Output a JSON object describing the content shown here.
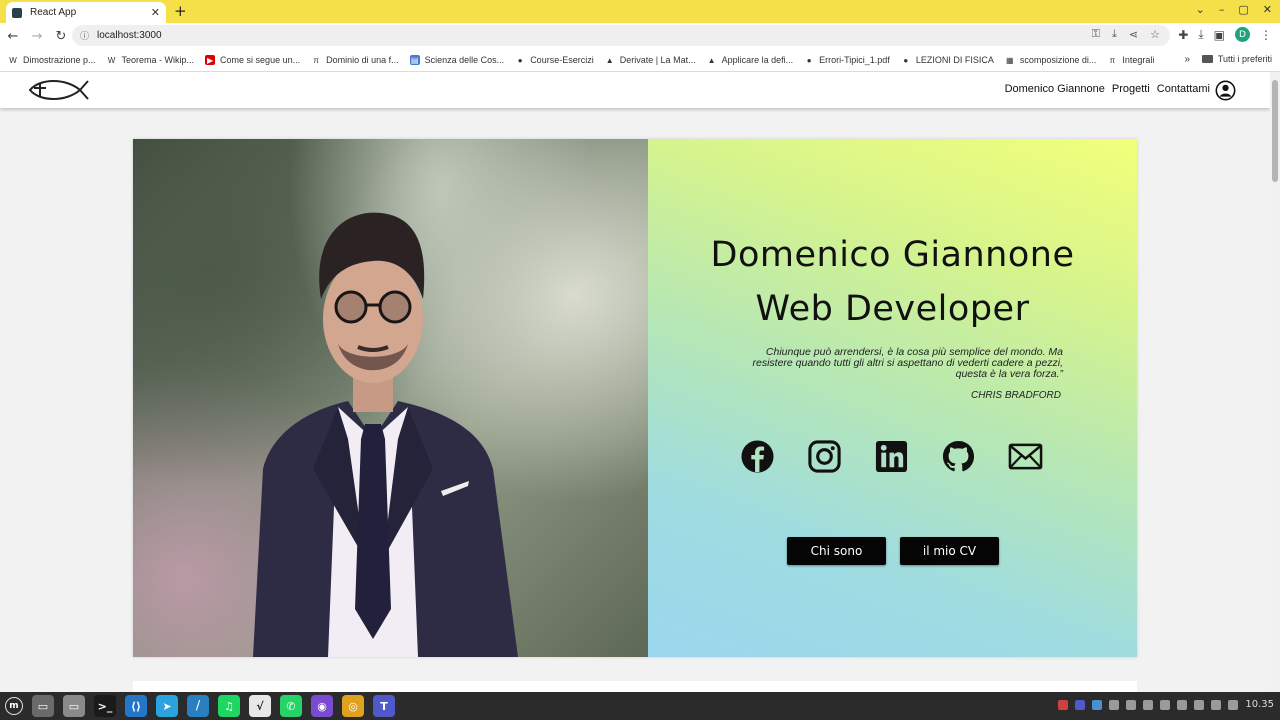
{
  "browser": {
    "tab_title": "React App",
    "tab_close": "✕",
    "new_tab": "+",
    "window_controls": [
      "⌄",
      "–",
      "▢",
      "✕"
    ],
    "url": "localhost:3000",
    "bookmarks": [
      {
        "label": "Dimostrazione p...",
        "icon": "W",
        "color": "#ffffff"
      },
      {
        "label": "Teorema - Wikip...",
        "icon": "W",
        "color": "#ffffff"
      },
      {
        "label": "Come si segue un...",
        "icon": "▶",
        "color": "#e00000"
      },
      {
        "label": "Dominio di una f...",
        "icon": "π",
        "color": "#ffffff"
      },
      {
        "label": "Scienza delle Cos...",
        "icon": "▤",
        "color": "#4a7bd0"
      },
      {
        "label": "Course-Esercizi",
        "icon": "●",
        "color": "#ffffff"
      },
      {
        "label": "Derivate | La Mat...",
        "icon": "▲",
        "color": "#ffffff"
      },
      {
        "label": "Applicare la defi...",
        "icon": "▲",
        "color": "#ffffff"
      },
      {
        "label": "Errori-Tipici_1.pdf",
        "icon": "●",
        "color": "#ffffff"
      },
      {
        "label": "LEZIONI DI FISICA",
        "icon": "●",
        "color": "#ffffff"
      },
      {
        "label": "scomposizione di...",
        "icon": "▦",
        "color": "#ffffff"
      },
      {
        "label": "Integrali",
        "icon": "π",
        "color": "#ffffff"
      }
    ],
    "bookmarks_more": "»",
    "all_bookmarks": "Tutti i preferiti",
    "profile_letter": "D"
  },
  "site": {
    "nav": [
      "Domenico Giannone",
      "Progetti",
      "Contattami"
    ],
    "hero": {
      "name": "Domenico Giannone",
      "role": "Web Developer",
      "quote": "Chiunque può arrendersi, è la cosa più semplice del mondo. Ma resistere quando tutti gli altri si aspettano di vederti cadere a pezzi, questa è la vera forza.”",
      "author": "CHRIS BRADFORD",
      "buttons": [
        "Chi sono",
        "il mio CV"
      ]
    },
    "socials": [
      "facebook-icon",
      "instagram-icon",
      "linkedin-icon",
      "github-icon",
      "mail-icon"
    ]
  },
  "taskbar": {
    "clock": "10.35",
    "apps": [
      {
        "name": "files-app",
        "label": "▭",
        "color": "#6a6a6a"
      },
      {
        "name": "folder-app",
        "label": "▭",
        "color": "#8a8a8a"
      },
      {
        "name": "terminal-app",
        "label": ">_",
        "color": "#1a1a1a"
      },
      {
        "name": "vscode-app",
        "label": "⟨⟩",
        "color": "#2477c8"
      },
      {
        "name": "telegram-app",
        "label": "➤",
        "color": "#2aa3df"
      },
      {
        "name": "editor-app",
        "label": "⧸",
        "color": "#2a7fc0"
      },
      {
        "name": "spotify-app",
        "label": "♫",
        "color": "#1ed760"
      },
      {
        "name": "math-app",
        "label": "√",
        "color": "#e8e8e8"
      },
      {
        "name": "whatsapp-app",
        "label": "✆",
        "color": "#25d366"
      },
      {
        "name": "github-app",
        "label": "◉",
        "color": "#7a4bd0"
      },
      {
        "name": "chrome-app",
        "label": "◎",
        "color": "#e0a020"
      },
      {
        "name": "teams-app",
        "label": "T",
        "color": "#5059c9"
      }
    ]
  }
}
